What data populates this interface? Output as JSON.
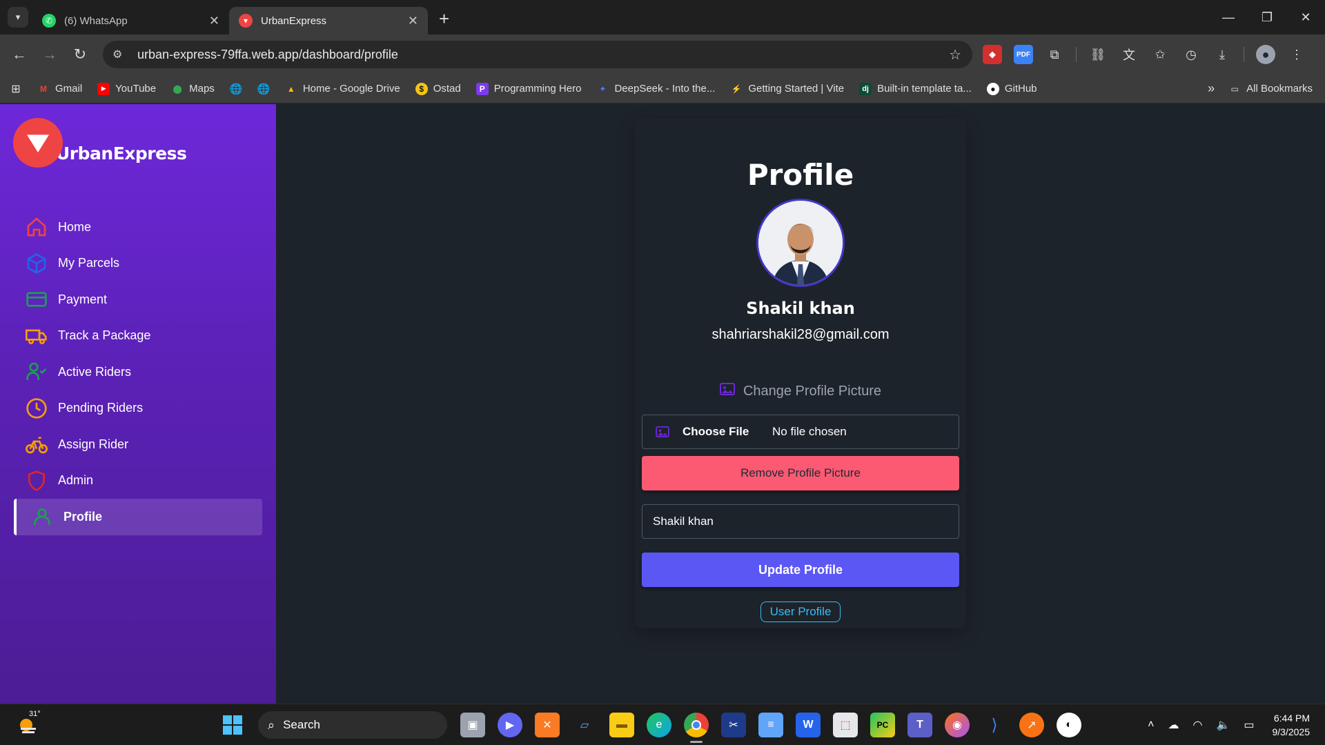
{
  "browser": {
    "tabs": [
      {
        "title": "(6) WhatsApp",
        "active": false
      },
      {
        "title": "UrbanExpress",
        "active": true
      }
    ],
    "url": "urban-express-79ffa.web.app/dashboard/profile",
    "bookmarks": [
      "Gmail",
      "YouTube",
      "Maps",
      "Home - Google Drive",
      "Ostad",
      "Programming Hero",
      "DeepSeek - Into the...",
      "Getting Started | Vite",
      "Built-in template ta...",
      "GitHub"
    ],
    "all_bookmarks_label": "All Bookmarks"
  },
  "app": {
    "brand": "UrbanExpress",
    "nav": [
      {
        "label": "Home",
        "icon": "home-icon",
        "color": "#ef4444"
      },
      {
        "label": "My Parcels",
        "icon": "box-icon",
        "color": "#2563eb"
      },
      {
        "label": "Payment",
        "icon": "credit-card-icon",
        "color": "#16a34a"
      },
      {
        "label": "Track a Package",
        "icon": "truck-icon",
        "color": "#f59e0b"
      },
      {
        "label": "Active Riders",
        "icon": "user-check-icon",
        "color": "#16a34a"
      },
      {
        "label": "Pending Riders",
        "icon": "clock-icon",
        "color": "#f59e0b"
      },
      {
        "label": "Assign Rider",
        "icon": "bicycle-icon",
        "color": "#f59e0b"
      },
      {
        "label": "Admin",
        "icon": "shield-icon",
        "color": "#dc2626"
      },
      {
        "label": "Profile",
        "icon": "user-icon",
        "color": "#16a34a",
        "active": true
      }
    ]
  },
  "profile": {
    "title": "Profile",
    "name": "Shakil khan",
    "email": "shahriarshakil28@gmail.com",
    "change_picture_label": "Change Profile Picture",
    "choose_file_label": "Choose File",
    "no_file_label": "No file chosen",
    "remove_button": "Remove Profile Picture",
    "name_input_value": "Shakil khan",
    "update_button": "Update Profile",
    "user_profile_link": "User Profile"
  },
  "taskbar": {
    "temperature": "31°",
    "search_label": "Search",
    "time": "6:44 PM",
    "date": "9/3/2025"
  }
}
